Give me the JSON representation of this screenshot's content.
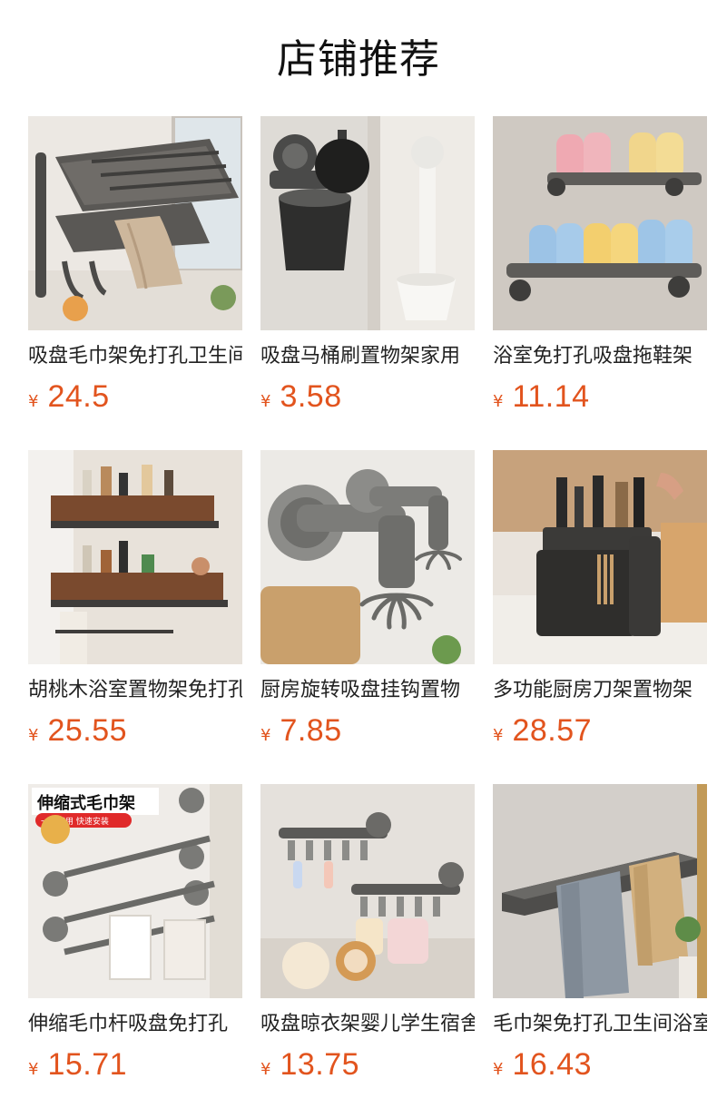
{
  "header": {
    "title": "店铺推荐"
  },
  "theme": {
    "price_color": "#e2541e",
    "text_color": "#222222"
  },
  "products": [
    {
      "name": "吸盘毛巾架免打孔卫生间",
      "currency": "¥",
      "price": "24.5",
      "image_icon": "folding-towel-rack-image"
    },
    {
      "name": "吸盘马桶刷置物架家用",
      "currency": "¥",
      "price": "3.58",
      "image_icon": "toilet-brush-holder-image"
    },
    {
      "name": "浴室免打孔吸盘拖鞋架",
      "currency": "¥",
      "price": "11.14",
      "image_icon": "slipper-rack-image"
    },
    {
      "name": "胡桃木浴室置物架免打孔",
      "currency": "¥",
      "price": "25.55",
      "image_icon": "walnut-shelf-image"
    },
    {
      "name": "厨房旋转吸盘挂钩置物",
      "currency": "¥",
      "price": "7.85",
      "image_icon": "rotating-hook-image"
    },
    {
      "name": "多功能厨房刀架置物架",
      "currency": "¥",
      "price": "28.57",
      "image_icon": "knife-block-image"
    },
    {
      "name": "伸缩毛巾杆吸盘免打孔",
      "currency": "¥",
      "price": "15.71",
      "image_icon": "telescopic-towel-bar-image",
      "badge_title": "伸缩式毛巾架",
      "badge_subtitle": "一吸即用 快速安装"
    },
    {
      "name": "吸盘晾衣架婴儿学生宿舍",
      "currency": "¥",
      "price": "13.75",
      "image_icon": "clothes-drying-rack-image"
    },
    {
      "name": "毛巾架免打孔卫生间浴室",
      "currency": "¥",
      "price": "16.43",
      "image_icon": "towel-bar-image"
    }
  ]
}
